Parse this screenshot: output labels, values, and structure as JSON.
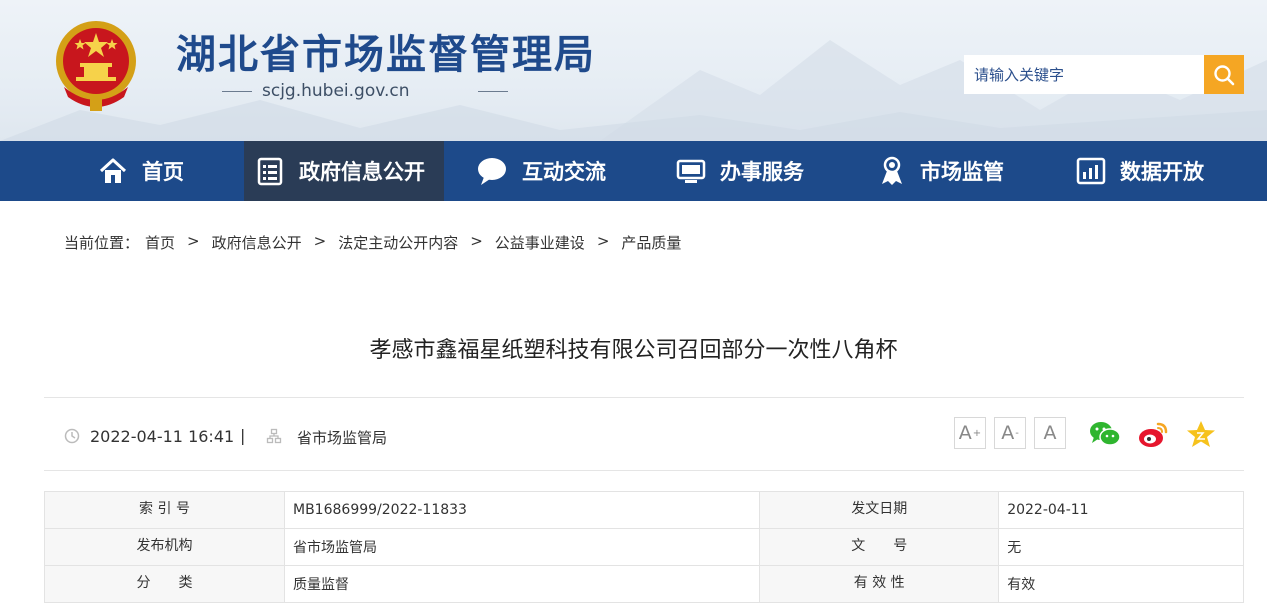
{
  "header": {
    "site_title": "湖北省市场监督管理局",
    "site_domain": "scjg.hubei.gov.cn",
    "search_placeholder": "请输入关键字"
  },
  "nav": {
    "items": [
      {
        "label": "首页",
        "icon": "home-icon"
      },
      {
        "label": "政府信息公开",
        "icon": "document-list-icon",
        "active": true
      },
      {
        "label": "互动交流",
        "icon": "chat-bubble-icon"
      },
      {
        "label": "办事服务",
        "icon": "monitor-icon"
      },
      {
        "label": "市场监管",
        "icon": "inspector-icon"
      },
      {
        "label": "数据开放",
        "icon": "bar-chart-icon"
      }
    ]
  },
  "breadcrumb": {
    "prefix": "当前位置：",
    "items": [
      "首页",
      "政府信息公开",
      "法定主动公开内容",
      "公益事业建设",
      "产品质量"
    ],
    "separator": ">"
  },
  "article": {
    "title": "孝感市鑫福星纸塑科技有限公司召回部分一次性八角杯",
    "date": "2022-04-11 16:41",
    "divider": "|",
    "source": "省市场监管局"
  },
  "font_controls": {
    "increase": "A",
    "decrease": "A",
    "reset": "A",
    "increase_sign": "+",
    "decrease_sign": "-"
  },
  "share_icons": [
    "wechat-icon",
    "weibo-icon",
    "favorite-star-icon"
  ],
  "info_table": {
    "rows": [
      {
        "k1": "索 引 号",
        "v1": "MB1686999/2022-11833",
        "k2": "发文日期",
        "v2": "2022-04-11"
      },
      {
        "k1": "发布机构",
        "v1": "省市场监管局",
        "k2": "文　　号",
        "v2": "无"
      },
      {
        "k1": "分　　类",
        "v1": "质量监督",
        "k2": "有 效 性",
        "v2": "有效"
      }
    ]
  },
  "colors": {
    "nav_bg": "#1d4a8a",
    "nav_active": "#2a3c56",
    "title_blue": "#1f4a8c",
    "search_button": "#f5a623"
  }
}
